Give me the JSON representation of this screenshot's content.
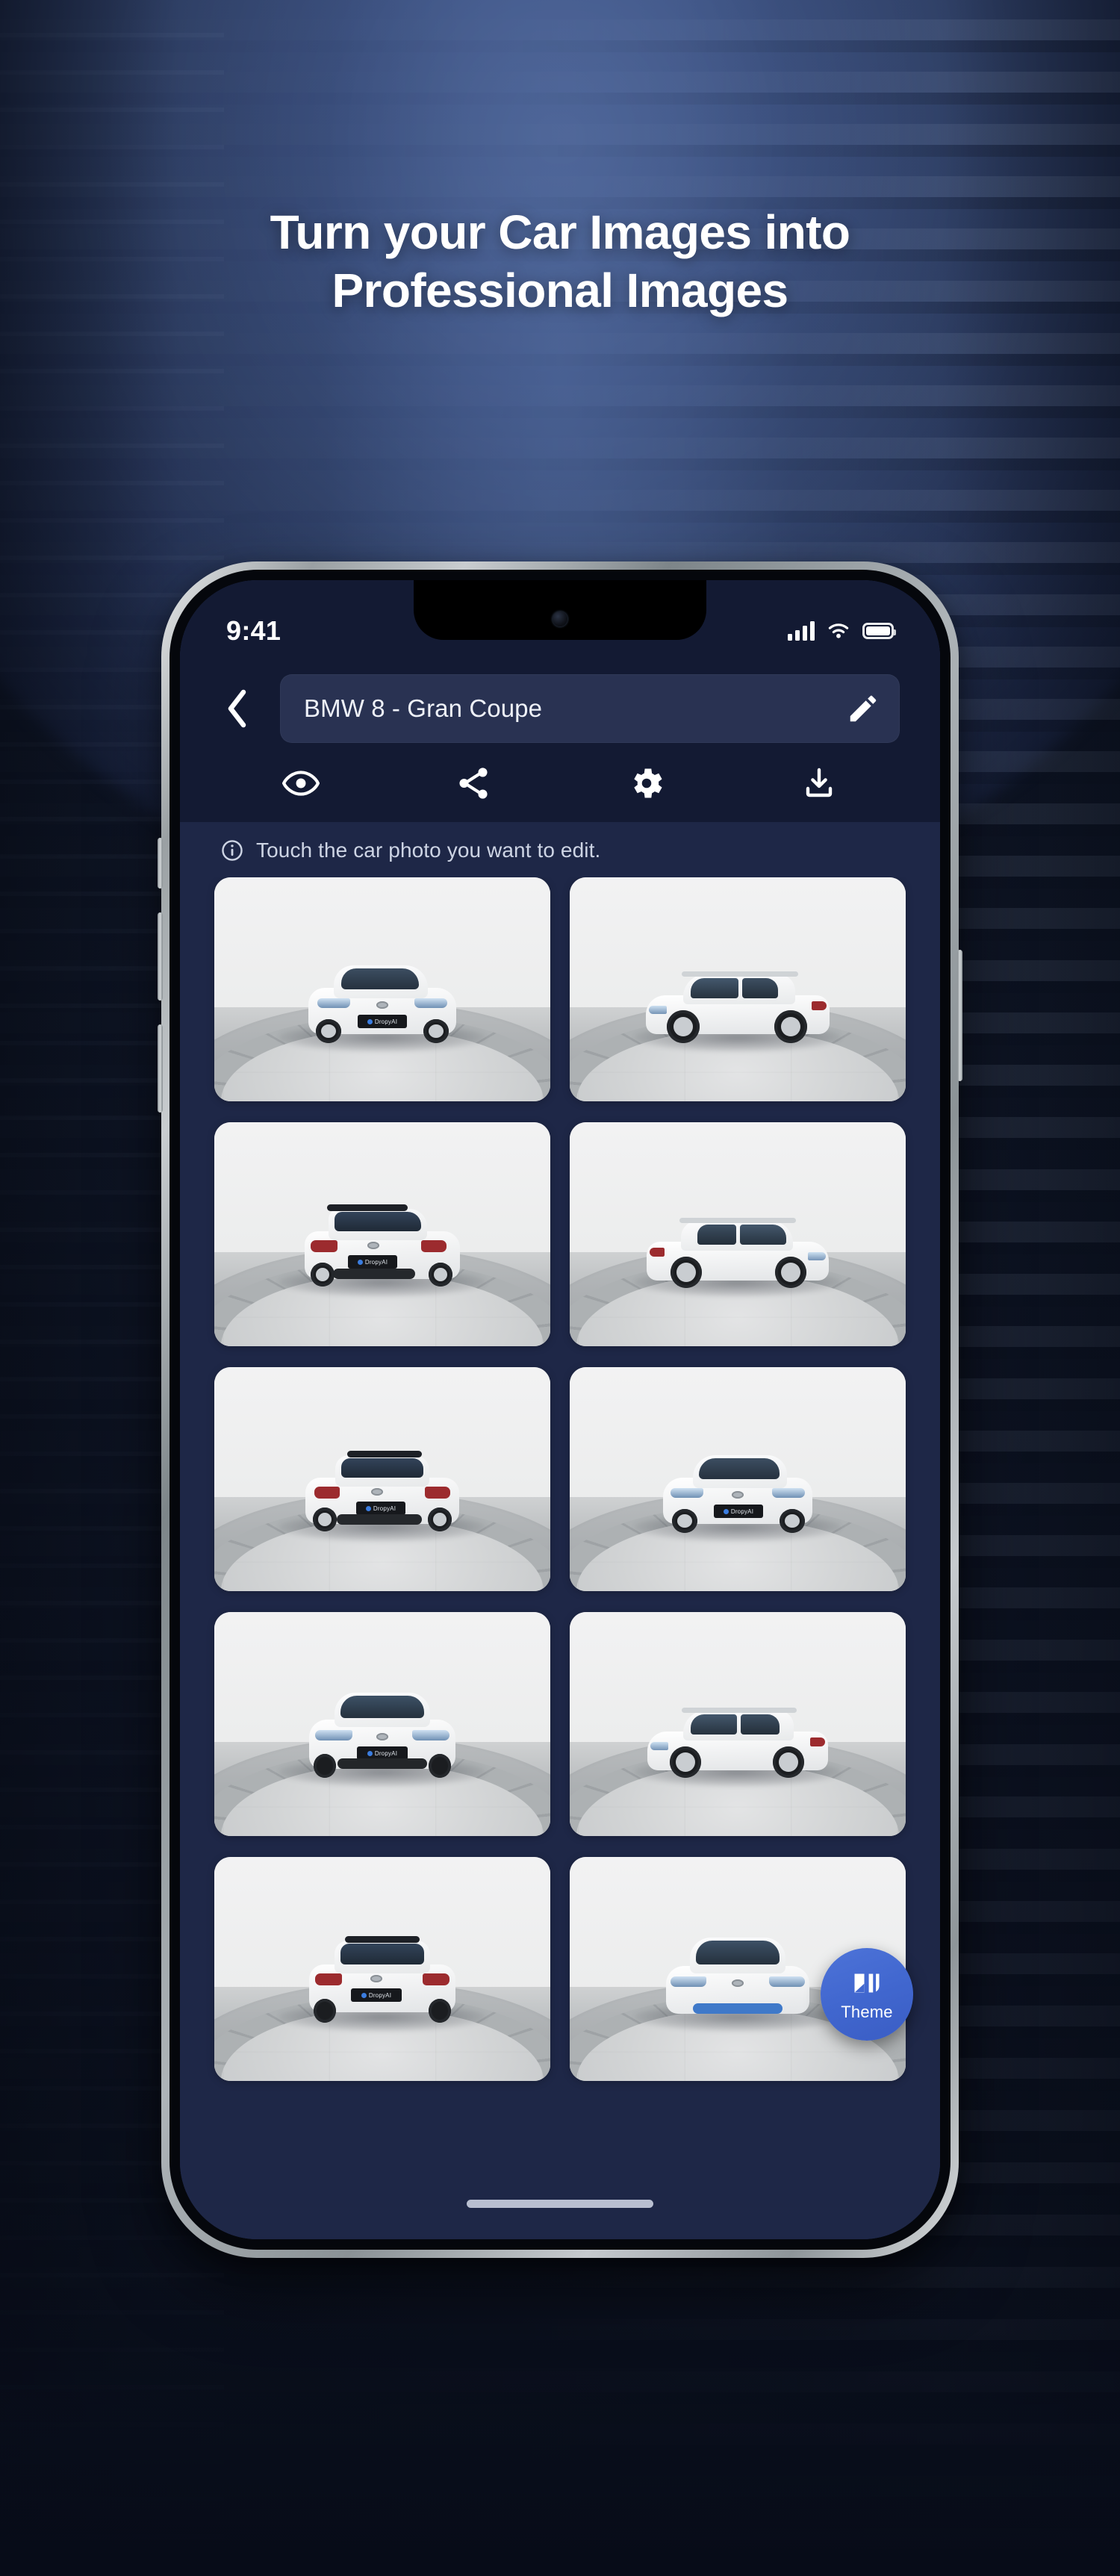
{
  "promo": {
    "headline_line1": "Turn your Car Images into",
    "headline_line2": "Professional Images",
    "background_accent": "#3e5383"
  },
  "device": {
    "status_bar": {
      "time": "9:41",
      "icons": [
        "cellular-signal-icon",
        "wifi-icon",
        "battery-icon"
      ]
    },
    "home_indicator": "home-indicator"
  },
  "app": {
    "header": {
      "back_icon": "chevron-left-icon",
      "name_field": {
        "value": "BMW 8 - Gran Coupe",
        "placeholder": "Vehicle name",
        "edit_icon": "pencil-icon"
      }
    },
    "toolbar": [
      {
        "name": "preview",
        "icon": "eye-icon"
      },
      {
        "name": "share",
        "icon": "share-icon"
      },
      {
        "name": "settings",
        "icon": "gear-icon"
      },
      {
        "name": "download",
        "icon": "download-icon"
      }
    ],
    "hint": {
      "icon": "info-icon",
      "text": "Touch the car photo you want to edit."
    },
    "gallery": {
      "columns": 2,
      "photos": [
        {
          "view": "front-three-quarter-left",
          "plate": "DropyAI",
          "color": "white"
        },
        {
          "view": "side-left",
          "plate": "",
          "color": "white"
        },
        {
          "view": "rear-three-quarter-left",
          "plate": "DropyAI",
          "color": "white"
        },
        {
          "view": "side-right-rear",
          "plate": "",
          "color": "white"
        },
        {
          "view": "rear-three-quarter-right",
          "plate": "DropyAI",
          "color": "white"
        },
        {
          "view": "front-three-quarter-right",
          "plate": "DropyAI",
          "color": "white"
        },
        {
          "view": "front",
          "plate": "DropyAI",
          "color": "white"
        },
        {
          "view": "side-right",
          "plate": "",
          "color": "white"
        },
        {
          "view": "rear",
          "plate": "DropyAI",
          "color": "white"
        },
        {
          "view": "front-top",
          "plate": "",
          "color": "white"
        }
      ]
    },
    "fab": {
      "label": "Theme",
      "icon": "theme-compare-icon",
      "color": "#4167cf"
    },
    "colors": {
      "screen_background": "#1e2747",
      "header_background": "#131a33",
      "field_background": "#293252",
      "accent": "#4167cf",
      "text_primary": "#eef1f8",
      "text_muted": "#cdd4e4"
    }
  }
}
